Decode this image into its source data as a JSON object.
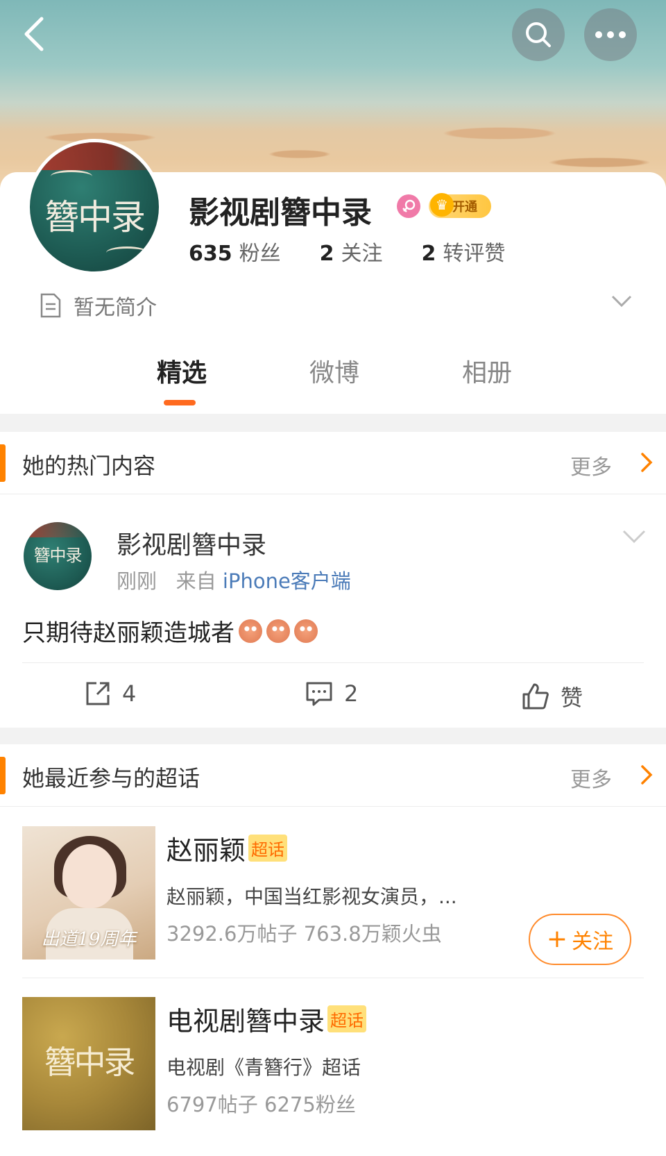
{
  "header": {
    "back_icon": "chevron-left-icon",
    "search_icon": "search-icon",
    "more_icon": "more-icon"
  },
  "profile": {
    "avatar_text": "簪中录",
    "name": "影视剧簪中录",
    "vip_label": "开通",
    "stats": [
      {
        "num": "635",
        "label": "粉丝"
      },
      {
        "num": "2",
        "label": "关注"
      },
      {
        "num": "2",
        "label": "转评赞"
      }
    ],
    "intro": "暂无简介"
  },
  "tabs": [
    {
      "label": "精选",
      "active": true
    },
    {
      "label": "微博",
      "active": false
    },
    {
      "label": "相册",
      "active": false
    }
  ],
  "hot": {
    "title": "她的热门内容",
    "more": "更多",
    "post": {
      "author": "影视剧簪中录",
      "avatar_text": "簪中录",
      "time": "刚刚",
      "from_prefix": "来自",
      "source": "iPhone客户端",
      "text": "只期待赵丽颖造城者",
      "repost_count": "4",
      "comment_count": "2",
      "like_label": "赞"
    }
  },
  "topics": {
    "title": "她最近参与的超话",
    "more": "更多",
    "items": [
      {
        "name": "赵丽颖",
        "tag": "超话",
        "desc": "赵丽颖，中国当红影视女演员，...",
        "stats": "3292.6万帖子 763.8万颖火虫",
        "thumb_caption": "出道19周年",
        "follow_label": "关注"
      },
      {
        "name": "电视剧簪中录",
        "tag": "超话",
        "desc": "电视剧《青簪行》超话",
        "stats": "6797帖子 6275粉丝",
        "thumb_caption": "簪中录"
      }
    ]
  },
  "colors": {
    "accent": "#ff8200",
    "link": "#4b7bb8",
    "tag_bg": "#ffe07a"
  }
}
